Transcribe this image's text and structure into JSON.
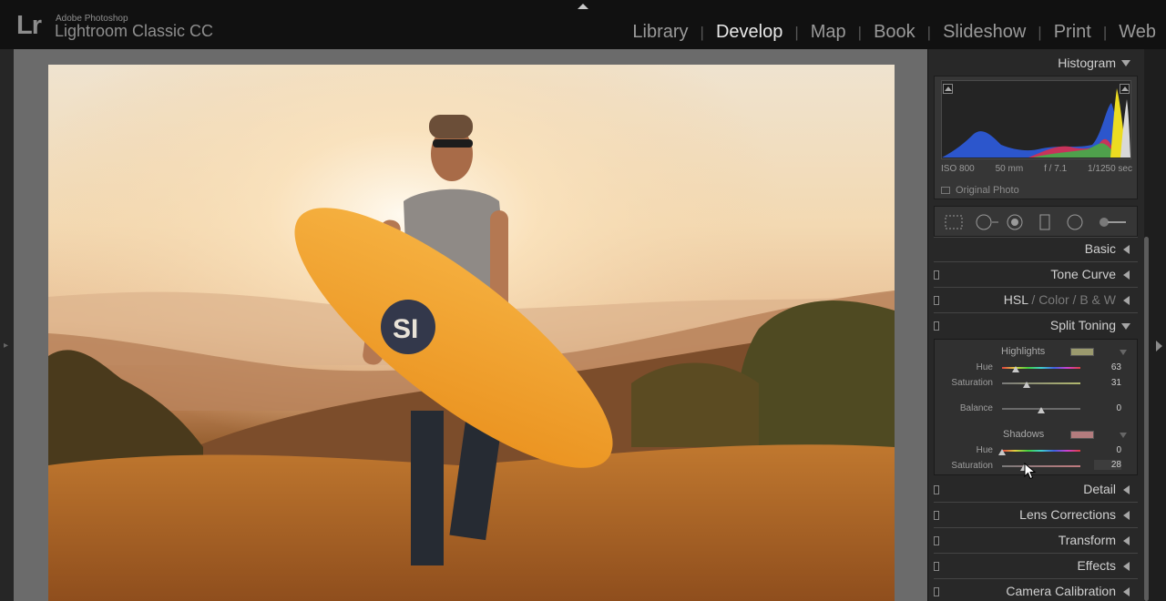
{
  "app": {
    "logo": "Lr",
    "brand_top": "Adobe Photoshop",
    "brand_main": "Lightroom Classic CC"
  },
  "modules": [
    "Library",
    "Develop",
    "Map",
    "Book",
    "Slideshow",
    "Print",
    "Web"
  ],
  "active_module": "Develop",
  "histogram": {
    "title": "Histogram",
    "iso": "ISO 800",
    "focal": "50 mm",
    "aperture": "f / 7.1",
    "shutter": "1/1250 sec",
    "original_photo": "Original Photo"
  },
  "sections": {
    "basic": "Basic",
    "tone_curve": "Tone Curve",
    "hsl": "HSL",
    "color": "Color",
    "bw": "B & W",
    "split_toning": "Split Toning",
    "detail": "Detail",
    "lens_corrections": "Lens Corrections",
    "transform": "Transform",
    "effects": "Effects",
    "camera_calibration": "Camera Calibration"
  },
  "split_toning": {
    "highlights": {
      "title": "Highlights",
      "swatch_color": "#9b9a6e",
      "hue_label": "Hue",
      "hue": "63",
      "hue_fraction": 0.175,
      "saturation_label": "Saturation",
      "saturation": "31",
      "saturation_fraction": 0.31
    },
    "balance": {
      "label": "Balance",
      "value": "0",
      "fraction": 0.5
    },
    "shadows": {
      "title": "Shadows",
      "swatch_color": "#b37c7e",
      "hue_label": "Hue",
      "hue": "0",
      "hue_fraction": 0.0,
      "saturation_label": "Saturation",
      "saturation": "28",
      "saturation_fraction": 0.28
    }
  },
  "colors": {
    "accent_text": "#e8e8e8",
    "panel_bg": "#282828",
    "top_bar": "#111111"
  }
}
